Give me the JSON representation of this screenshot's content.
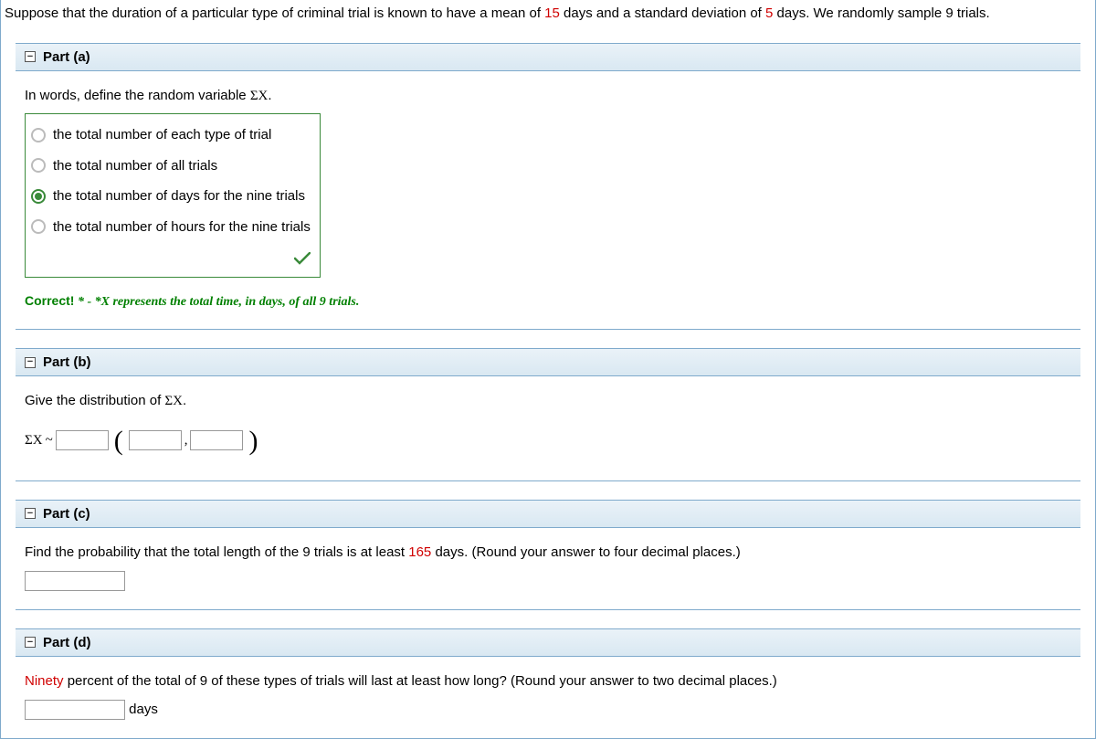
{
  "question": {
    "pre": "Suppose that the duration of a particular type of criminal trial is known to have a mean of ",
    "mean": "15",
    "mid1": " days and a standard deviation of ",
    "sd": "5",
    "post": " days. We randomly sample 9 trials."
  },
  "parts": {
    "a": {
      "title": "Part (a)",
      "prompt_pre": "In words, define the random variable ",
      "prompt_var": "ΣX",
      "prompt_post": ".",
      "options": [
        "the total number of each type of trial",
        "the total number of all trials",
        "the total number of days for the nine trials",
        "the total number of hours for the nine trials"
      ],
      "feedback_label": "Correct!",
      "feedback_text": " * - *X represents the total time, in days, of all 9 trials."
    },
    "b": {
      "title": "Part (b)",
      "prompt_pre": "Give the distribution of ",
      "prompt_var": "ΣX",
      "prompt_post": ".",
      "line_var": "ΣX",
      "tilde": " ~ ",
      "comma": ","
    },
    "c": {
      "title": "Part (c)",
      "prompt_pre": "Find the probability that the total length of the 9 trials is at least ",
      "val": "165",
      "prompt_post": " days. (Round your answer to four decimal places.)"
    },
    "d": {
      "title": "Part (d)",
      "prompt_red": "Ninety",
      "prompt_post": " percent of the total of 9 of these types of trials will last at least how long? (Round your answer to two decimal places.)",
      "unit": "days"
    }
  }
}
